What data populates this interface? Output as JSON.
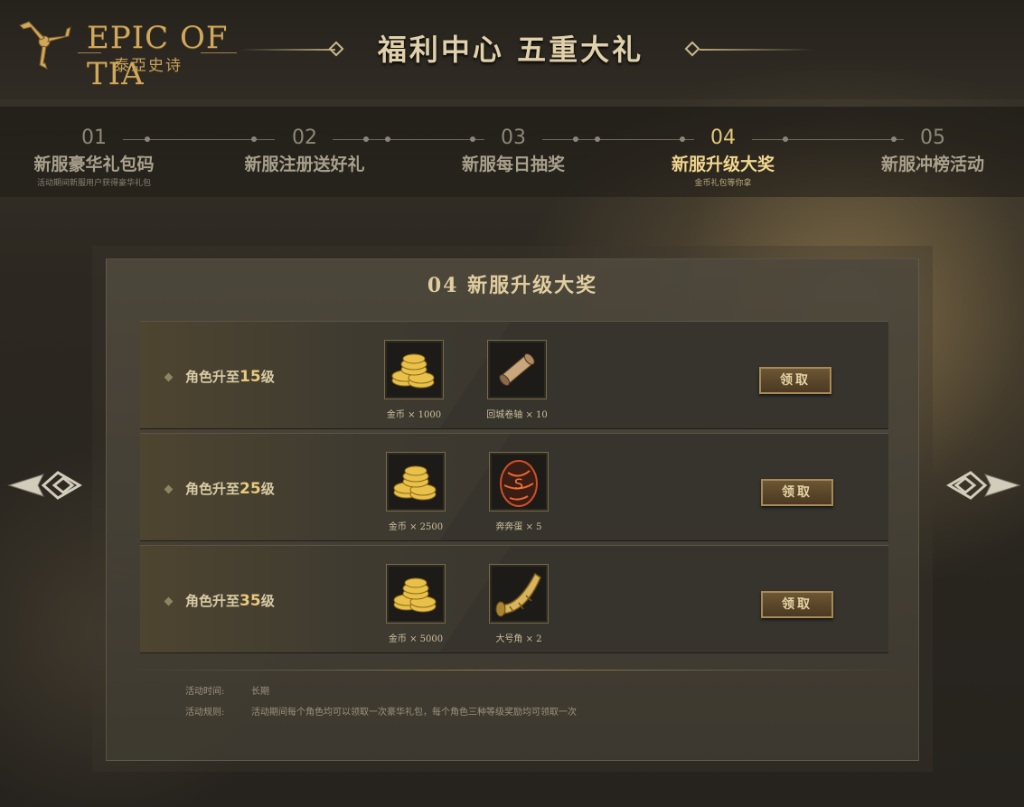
{
  "logo": {
    "en": "EPIC OF TIA",
    "cn": "泰亞史诗"
  },
  "page_title": "福利中心  五重大礼",
  "steps": [
    {
      "num": "01",
      "label": "新服豪华礼包码",
      "sub": "活动期间新服用户获得豪华礼包"
    },
    {
      "num": "02",
      "label": "新服注册送好礼",
      "sub": ""
    },
    {
      "num": "03",
      "label": "新服每日抽奖",
      "sub": ""
    },
    {
      "num": "04",
      "label": "新服升级大奖",
      "sub": "金币礼包等你拿"
    },
    {
      "num": "05",
      "label": "新服冲榜活动",
      "sub": ""
    }
  ],
  "active_step": "04",
  "panel_title": "04  新服升级大奖",
  "rewards": [
    {
      "label_prefix": "角色升至",
      "level": "15",
      "label_suffix": "级",
      "items": [
        {
          "name": "金币 × 1000",
          "icon": "gold-coins-icon"
        },
        {
          "name": "回城卷轴 × 10",
          "icon": "scroll-icon"
        }
      ],
      "button": "领取"
    },
    {
      "label_prefix": "角色升至",
      "level": "25",
      "label_suffix": "级",
      "items": [
        {
          "name": "金币 × 2500",
          "icon": "gold-coins-icon"
        },
        {
          "name": "奔奔蛋 × 5",
          "icon": "egg-icon"
        }
      ],
      "button": "领取"
    },
    {
      "label_prefix": "角色升至",
      "level": "35",
      "label_suffix": "级",
      "items": [
        {
          "name": "金币 × 5000",
          "icon": "gold-coins-icon"
        },
        {
          "name": "大号角 × 2",
          "icon": "horn-icon"
        }
      ],
      "button": "领取"
    }
  ],
  "info": {
    "time_label": "活动时间:",
    "time_value": "长期",
    "rule_label": "活动规则:",
    "rule_value": "活动期间每个角色均可以领取一次豪华礼包，每个角色三种等级奖励均可领取一次"
  },
  "colors": {
    "accent_gold": "#e8c97d",
    "active_step": "#f1d68e",
    "button_border": "#a88a56"
  }
}
